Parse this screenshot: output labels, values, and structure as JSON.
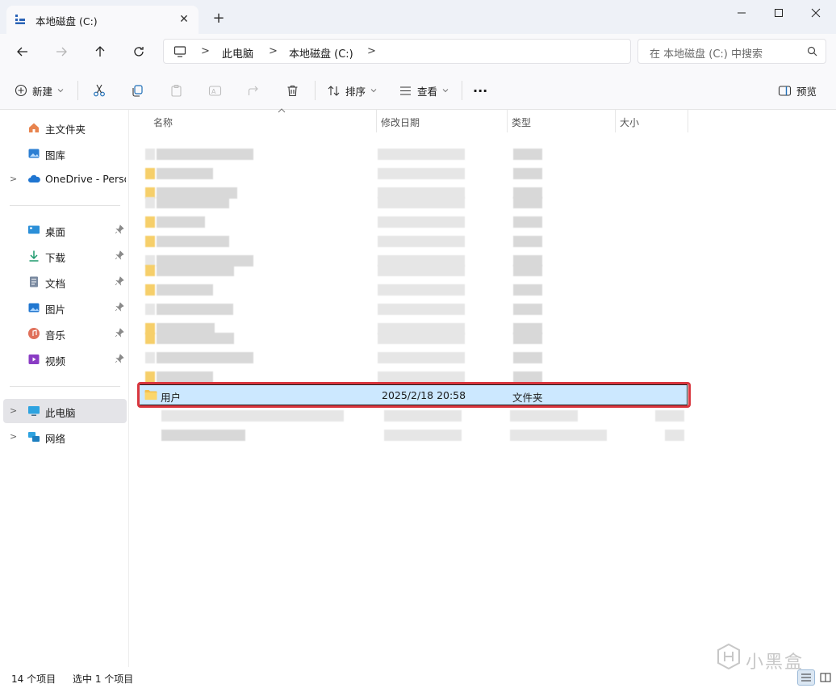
{
  "tab": {
    "title": "本地磁盘 (C:)",
    "close_glyph": "✕",
    "new_tab_glyph": "+"
  },
  "window": {
    "minimize_glyph": "—",
    "maximize_glyph": "☐",
    "close_glyph": "✕"
  },
  "address": {
    "breadcrumbs": [
      "此电脑",
      "本地磁盘 (C:)"
    ],
    "separator": ">",
    "search_placeholder": "在 本地磁盘 (C:) 中搜索"
  },
  "toolbar": {
    "new_label": "新建",
    "sort_label": "排序",
    "view_label": "查看",
    "more_label": "···",
    "preview_label": "预览"
  },
  "sidebar": {
    "items": [
      {
        "label": "主文件夹",
        "icon": "home-icon"
      },
      {
        "label": "图库",
        "icon": "gallery-icon"
      },
      {
        "label": "OneDrive - Perso",
        "icon": "onedrive-icon"
      },
      {
        "label": "桌面",
        "icon": "desktop-icon"
      },
      {
        "label": "下载",
        "icon": "download-icon"
      },
      {
        "label": "文档",
        "icon": "documents-icon"
      },
      {
        "label": "图片",
        "icon": "pictures-icon"
      },
      {
        "label": "音乐",
        "icon": "music-icon"
      },
      {
        "label": "视频",
        "icon": "videos-icon"
      },
      {
        "label": "此电脑",
        "icon": "this-pc-icon"
      },
      {
        "label": "网络",
        "icon": "network-icon"
      }
    ]
  },
  "columns": {
    "name": "名称",
    "date": "修改日期",
    "type": "类型",
    "size": "大小"
  },
  "highlighted_file": {
    "name": "用户",
    "date": "2025/2/18 20:58",
    "type": "文件夹"
  },
  "status": {
    "item_count": "14 个项目",
    "selected": "选中 1 个项目"
  },
  "watermark": {
    "text": "小黑盒"
  },
  "colors": {
    "selection": "#cce8ff",
    "highlight_border": "#d9363e",
    "folder": "#f6cf6a"
  }
}
